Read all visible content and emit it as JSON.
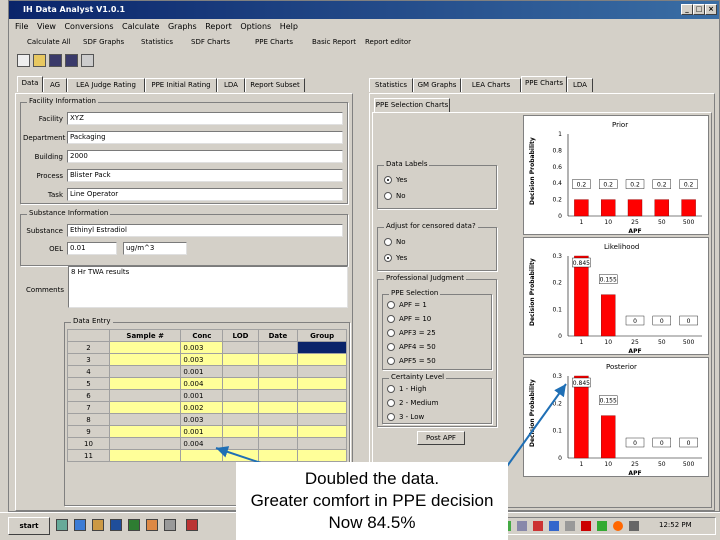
{
  "window": {
    "title": "IH Data Analyst V1.0.1"
  },
  "menu": [
    "File",
    "View",
    "Conversions",
    "Calculate",
    "Graphs",
    "Report",
    "Options",
    "Help"
  ],
  "toolbar": [
    "Calculate All",
    "SDF Graphs",
    "Statistics",
    "SDF Charts",
    "PPE Charts",
    "Basic Report",
    "Report editor"
  ],
  "left_tabs": [
    "Data",
    "AG",
    "LEA Judge Rating",
    "PPE Initial Rating",
    "LDA",
    "Report Subset"
  ],
  "right_tabs": [
    "Statistics",
    "GM Graphs",
    "LEA Charts",
    "PPE Charts",
    "LDA"
  ],
  "facility": {
    "title": "Facility Information",
    "fields": [
      {
        "label": "Facility",
        "value": "XYZ"
      },
      {
        "label": "Department",
        "value": "Packaging"
      },
      {
        "label": "Building",
        "value": "2000"
      },
      {
        "label": "Process",
        "value": "Blister Pack"
      },
      {
        "label": "Task",
        "value": "Line Operator"
      }
    ]
  },
  "substance": {
    "title": "Substance Information",
    "substance_label": "Substance",
    "substance_value": "Ethinyl Estradiol",
    "oel_label": "OEL",
    "oel_value": "0.01",
    "unit": "ug/m^3"
  },
  "comments": {
    "label": "Comments",
    "value": "8 Hr TWA results"
  },
  "data_entry": {
    "title": "Data Entry",
    "headers": [
      "Sample #",
      "Conc",
      "LOD",
      "Date",
      "Group"
    ],
    "rows": [
      {
        "n": "2",
        "conc": "0.003"
      },
      {
        "n": "3",
        "conc": "0.003"
      },
      {
        "n": "4",
        "conc": "0.001"
      },
      {
        "n": "5",
        "conc": "0.004"
      },
      {
        "n": "6",
        "conc": "0.001"
      },
      {
        "n": "7",
        "conc": "0.002"
      },
      {
        "n": "8",
        "conc": "0.003"
      },
      {
        "n": "9",
        "conc": "0.001"
      },
      {
        "n": "10",
        "conc": "0.004"
      },
      {
        "n": "11",
        "conc": ""
      }
    ]
  },
  "ppe": {
    "tab": "PPE Selection Charts",
    "data_labels": {
      "title": "Data Labels",
      "options": [
        "Yes",
        "No"
      ],
      "selected": 0
    },
    "adjust": {
      "title": "Adjust for censored data?",
      "options": [
        "No",
        "Yes"
      ],
      "selected": 1
    },
    "pj": {
      "title": "Professional Judgment"
    },
    "ppe_selection": {
      "title": "PPE Selection",
      "options": [
        "APF = 1",
        "APF = 10",
        "APF3 = 25",
        "APF4 = 50",
        "APF5 = 50"
      ]
    },
    "certainty": {
      "title": "Certainty Level",
      "options": [
        "1 - High",
        "2 - Medium",
        "3 - Low"
      ]
    },
    "button": "Post APF"
  },
  "charts": {
    "xlabel": "APF",
    "ylabel": "Decision Probability",
    "categories": [
      "1",
      "10",
      "25",
      "50",
      "500"
    ],
    "c1": {
      "title": "Prior",
      "labels": [
        "0.2",
        "0.2",
        "0.2",
        "0.2",
        "0.2"
      ],
      "values": [
        0.2,
        0.2,
        0.2,
        0.2,
        0.2
      ],
      "yticks": [
        "1",
        "0.8",
        "0.6",
        "0.4",
        "0.2",
        "0"
      ]
    },
    "c2": {
      "title": "Likelihood",
      "labels": [
        "0.845",
        "0.155",
        "0",
        "0",
        "0"
      ],
      "values": [
        0.845,
        0.155,
        0,
        0,
        0
      ],
      "yticks": [
        "0.3",
        "0.2",
        "0.1",
        "0"
      ]
    },
    "c3": {
      "title": "Posterior",
      "labels": [
        "0.845",
        "0.155",
        "0",
        "0",
        "0"
      ],
      "values": [
        0.845,
        0.155,
        0,
        0,
        0
      ],
      "yticks": [
        "0.3",
        "0.2",
        "0.1",
        "0"
      ]
    }
  },
  "chart_data": [
    {
      "type": "bar",
      "title": "Prior",
      "xlabel": "APF",
      "ylabel": "Decision Probability",
      "categories": [
        "1",
        "10",
        "25",
        "50",
        "500"
      ],
      "values": [
        0.2,
        0.2,
        0.2,
        0.2,
        0.2
      ],
      "ylim": [
        0,
        1
      ]
    },
    {
      "type": "bar",
      "title": "Likelihood",
      "xlabel": "APF",
      "ylabel": "Decision Probability",
      "categories": [
        "1",
        "10",
        "25",
        "50",
        "500"
      ],
      "values": [
        0.845,
        0.155,
        0,
        0,
        0
      ]
    },
    {
      "type": "bar",
      "title": "Posterior",
      "xlabel": "APF",
      "ylabel": "Decision Probability",
      "categories": [
        "1",
        "10",
        "25",
        "50",
        "500"
      ],
      "values": [
        0.845,
        0.155,
        0,
        0,
        0
      ]
    }
  ],
  "taskbar": {
    "start": "start",
    "clock": "12:52 PM"
  },
  "callout": {
    "line1": "Doubled the data.",
    "line2": "Greater comfort in PPE decision",
    "line3": "Now 84.5%"
  },
  "colors": {
    "bar": "#ff0000",
    "arrow": "#1f6fb5",
    "highlight": "#ffff99"
  }
}
